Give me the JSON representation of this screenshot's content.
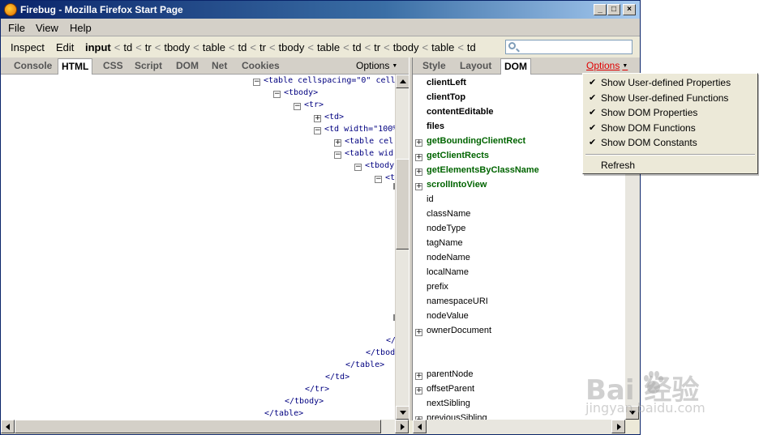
{
  "window": {
    "title": "Firebug - Mozilla Firefox Start Page",
    "controls": {
      "minimize": "_",
      "maximize": "□",
      "close": "×"
    }
  },
  "menubar": {
    "items": [
      {
        "label": "File",
        "access": "F"
      },
      {
        "label": "View",
        "access": ""
      },
      {
        "label": "Help",
        "access": ""
      }
    ]
  },
  "toolbar": {
    "inspect_label": "Inspect",
    "edit_label": "Edit",
    "breadcrumbs": [
      "input",
      "td",
      "tr",
      "tbody",
      "table",
      "td",
      "tr",
      "tbody",
      "table",
      "td",
      "tr",
      "tbody",
      "table",
      "td"
    ],
    "breadcrumb_separator": "<",
    "search_value": ""
  },
  "left_panel": {
    "tabs": [
      "Console",
      "HTML",
      "CSS",
      "Script",
      "DOM",
      "Net",
      "Cookies"
    ],
    "active_tab": "HTML",
    "options_label": "Options",
    "tree": [
      {
        "toggle": "⊟",
        "text": "<table cellspacing=\"0\" cell"
      },
      {
        "toggle": "⊟",
        "text": "<tbody>"
      },
      {
        "toggle": "⊟",
        "text": "<tr>"
      },
      {
        "toggle": "⊞",
        "text": "<td>"
      },
      {
        "toggle": "⊟",
        "text": "<td width=\"100%"
      },
      {
        "toggle": "⊞",
        "text": "<table cel"
      },
      {
        "toggle": "⊟",
        "text": "<table wid"
      },
      {
        "toggle": "⊟",
        "text": "<tbody"
      },
      {
        "toggle": "⊟",
        "text": "<t"
      },
      {
        "toggle": "",
        "text": "</"
      },
      {
        "toggle": "",
        "text": "</tbody"
      },
      {
        "toggle": "",
        "text": "</table>"
      },
      {
        "toggle": "",
        "text": "</td>"
      },
      {
        "toggle": "",
        "text": "</tr>"
      },
      {
        "toggle": "",
        "text": "</tbody>"
      },
      {
        "toggle": "",
        "text": "</table>"
      }
    ]
  },
  "right_panel": {
    "tabs": [
      "Style",
      "Layout",
      "DOM"
    ],
    "active_tab": "DOM",
    "options_label": "Options",
    "properties": [
      {
        "name": "clientLeft",
        "kind": "bold",
        "expandable": false
      },
      {
        "name": "clientTop",
        "kind": "bold",
        "expandable": false
      },
      {
        "name": "contentEditable",
        "kind": "bold",
        "expandable": false
      },
      {
        "name": "files",
        "kind": "bold",
        "expandable": false
      },
      {
        "name": "getBoundingClientRect",
        "kind": "fn",
        "expandable": true
      },
      {
        "name": "getClientRects",
        "kind": "fn",
        "expandable": true
      },
      {
        "name": "getElementsByClassName",
        "kind": "fn",
        "expandable": true
      },
      {
        "name": "scrollIntoView",
        "kind": "fn",
        "expandable": true
      },
      {
        "name": "id",
        "kind": "plain",
        "expandable": false
      },
      {
        "name": "className",
        "kind": "plain",
        "expandable": false
      },
      {
        "name": "nodeType",
        "kind": "plain",
        "expandable": false
      },
      {
        "name": "tagName",
        "kind": "plain",
        "expandable": false
      },
      {
        "name": "nodeName",
        "kind": "plain",
        "expandable": false
      },
      {
        "name": "localName",
        "kind": "plain",
        "expandable": false
      },
      {
        "name": "prefix",
        "kind": "plain",
        "expandable": false
      },
      {
        "name": "namespaceURI",
        "kind": "plain",
        "expandable": false
      },
      {
        "name": "nodeValue",
        "kind": "plain",
        "expandable": false
      },
      {
        "name": "ownerDocument",
        "kind": "plain",
        "expandable": true
      },
      {
        "name": "",
        "kind": "plain",
        "expandable": false
      },
      {
        "name": "",
        "kind": "plain",
        "expandable": false
      },
      {
        "name": "parentNode",
        "kind": "plain",
        "expandable": true
      },
      {
        "name": "offsetParent",
        "kind": "plain",
        "expandable": true
      },
      {
        "name": "nextSibling",
        "kind": "plain",
        "expandable": false
      },
      {
        "name": "previousSibling",
        "kind": "plain",
        "expandable": true
      }
    ]
  },
  "options_menu": {
    "items": [
      {
        "label": "Show User-defined Properties",
        "checked": true
      },
      {
        "label": "Show User-defined Functions",
        "checked": true
      },
      {
        "label": "Show DOM Properties",
        "checked": true
      },
      {
        "label": "Show DOM Functions",
        "checked": true
      },
      {
        "label": "Show DOM Constants",
        "checked": true
      }
    ],
    "refresh_label": "Refresh"
  },
  "watermark": {
    "main": "Bai  经验",
    "sub": "jingyan.baidu.com"
  },
  "colors": {
    "titlebar_start": "#0a246a",
    "titlebar_end": "#a6caf0",
    "function_green": "#006400",
    "tag_blue": "#000080",
    "attr_value_red": "#ff0000",
    "options_red": "#e00000"
  }
}
